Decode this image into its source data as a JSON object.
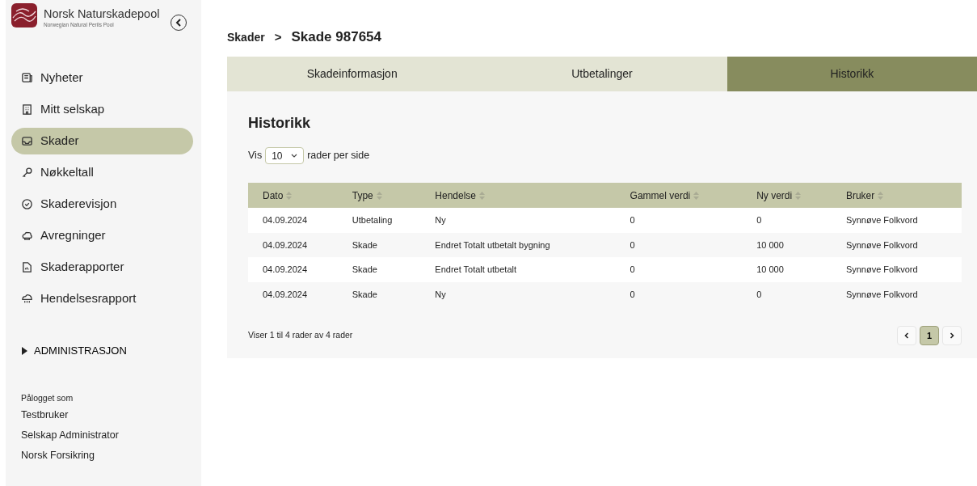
{
  "brand": {
    "name": "Norsk Naturskadepool",
    "tagline": "Norwegian Natural Perils Pool"
  },
  "nav": [
    {
      "label": "Nyheter",
      "selected": false
    },
    {
      "label": "Mitt selskap",
      "selected": false
    },
    {
      "label": "Skader",
      "selected": true
    },
    {
      "label": "Nøkkeltall",
      "selected": false
    },
    {
      "label": "Skaderevisjon",
      "selected": false
    },
    {
      "label": "Avregninger",
      "selected": false
    },
    {
      "label": "Skaderapporter",
      "selected": false
    },
    {
      "label": "Hendelsesrapport",
      "selected": false
    }
  ],
  "admin": {
    "label": "ADMINISTRASJON",
    "expanded": false
  },
  "login": {
    "caption": "Pålogget som",
    "lines": [
      "Testbruker",
      "Selskap Administrator",
      "Norsk Forsikring"
    ]
  },
  "breadcrumb": {
    "parent": "Skader",
    "separator": ">",
    "current": "Skade 987654"
  },
  "tabs": [
    {
      "label": "Skadeinformasjon",
      "selected": false
    },
    {
      "label": "Utbetalinger",
      "selected": false
    },
    {
      "label": "Historikk",
      "selected": true
    }
  ],
  "section_title": "Historikk",
  "page_size": {
    "prefix": "Vis",
    "value": "10",
    "suffix": "rader per side"
  },
  "table": {
    "columns": [
      "Dato",
      "Type",
      "Hendelse",
      "Gammel verdi",
      "Ny verdi",
      "Bruker"
    ],
    "rows": [
      [
        "04.09.2024",
        "Utbetaling",
        "Ny",
        "0",
        "0",
        "Synnøve Folkvord"
      ],
      [
        "04.09.2024",
        "Skade",
        "Endret Totalt utbetalt bygning",
        "0",
        "10 000",
        "Synnøve Folkvord"
      ],
      [
        "04.09.2024",
        "Skade",
        "Endret Totalt utbetalt",
        "0",
        "10 000",
        "Synnøve Folkvord"
      ],
      [
        "04.09.2024",
        "Skade",
        "Ny",
        "0",
        "0",
        "Synnøve Folkvord"
      ]
    ]
  },
  "summary": "Viser 1 til 4 rader av 4 rader",
  "pagination": {
    "pages": [
      {
        "label": "1",
        "selected": true
      }
    ]
  }
}
